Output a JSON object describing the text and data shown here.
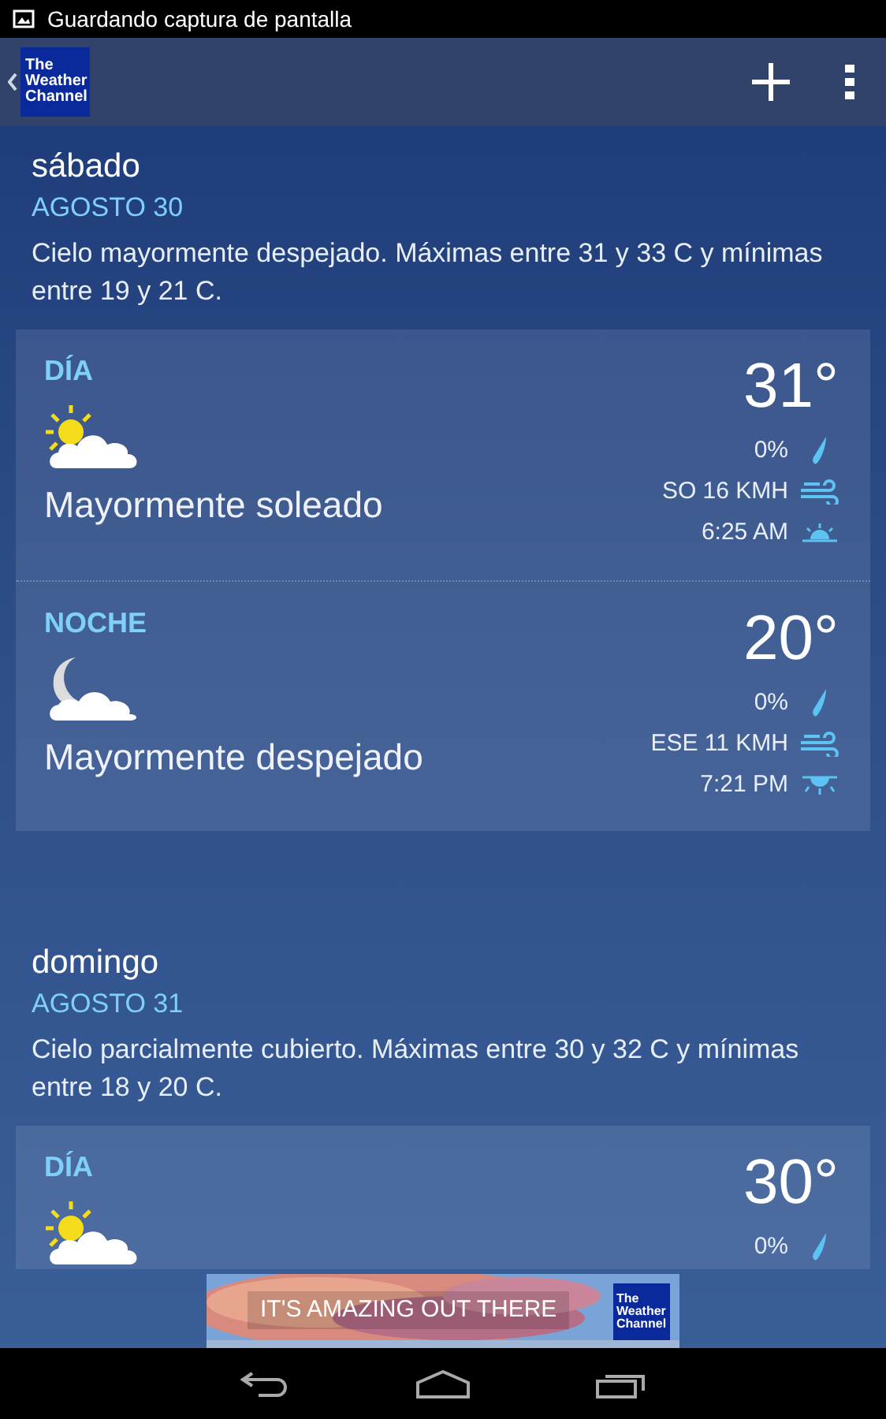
{
  "status_bar": {
    "notification": "Guardando captura de pantalla"
  },
  "app_bar": {
    "logo": "The Weather Channel"
  },
  "days": [
    {
      "name": "sábado",
      "date": "AGOSTO 30",
      "summary": "Cielo mayormente despejado. Máximas entre 31 y 33 C y mínimas entre 19 y 21 C.",
      "periods": [
        {
          "label": "DÍA",
          "kind": "partly_sunny",
          "condition": "Mayormente soleado",
          "temp": "31°",
          "precip": "0%",
          "wind": "SO 16 KMH",
          "sun": {
            "kind": "sunrise",
            "time": "6:25 AM"
          }
        },
        {
          "label": "NOCHE",
          "kind": "moon_cloud",
          "condition": "Mayormente despejado",
          "temp": "20°",
          "precip": "0%",
          "wind": "ESE 11 KMH",
          "sun": {
            "kind": "sunset",
            "time": "7:21 PM"
          }
        }
      ]
    },
    {
      "name": "domingo",
      "date": "AGOSTO 31",
      "summary": "Cielo parcialmente cubierto. Máximas entre 30 y 32 C y mínimas entre 18 y 20 C.",
      "periods": [
        {
          "label": "DÍA",
          "kind": "partly_sunny",
          "temp": "30°",
          "precip": "0%"
        }
      ]
    }
  ],
  "ad": {
    "headline": "IT'S AMAZING OUT THERE",
    "logo": "The Weather Channel"
  }
}
